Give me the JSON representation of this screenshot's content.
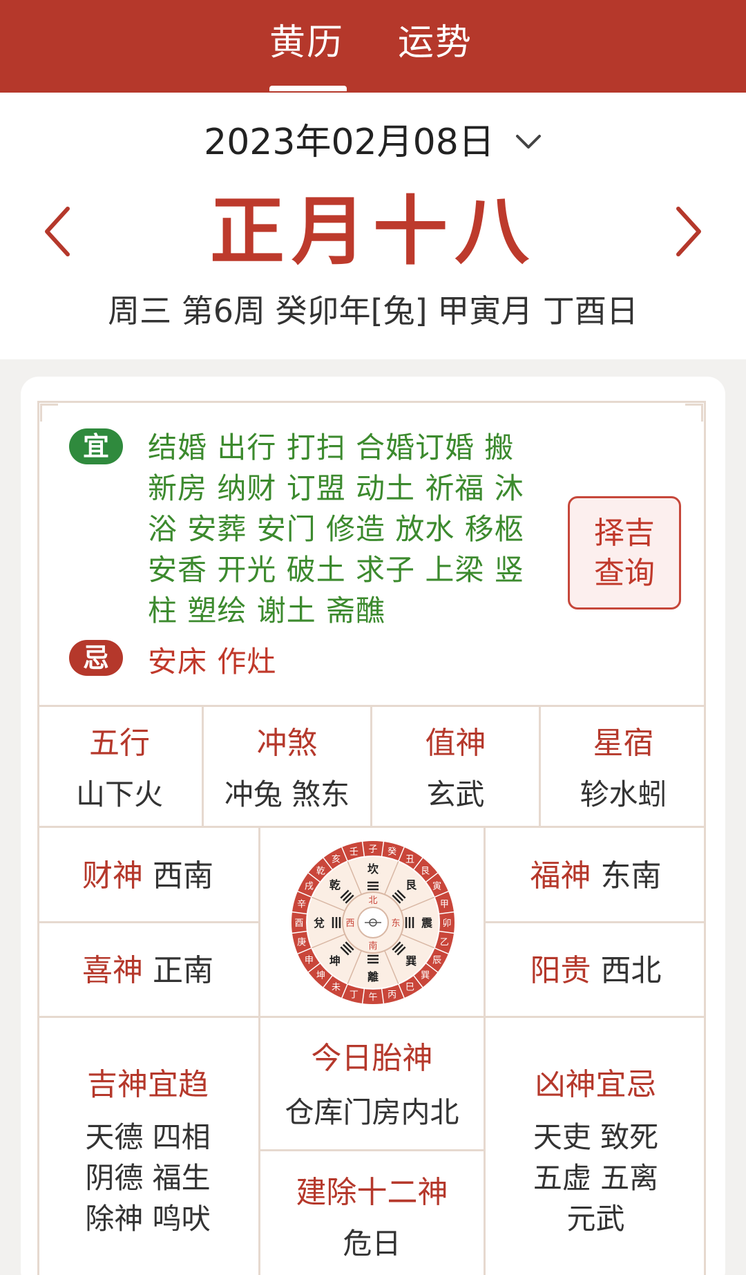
{
  "tabs": [
    {
      "label": "黄历",
      "active": true
    },
    {
      "label": "运势",
      "active": false
    }
  ],
  "header": {
    "date": "2023年02月08日",
    "lunar_date": "正月十八",
    "ganzhi": "周三 第6周 癸卯年[兔] 甲寅月 丁酉日"
  },
  "yi": {
    "badge": "宜",
    "lines": [
      "结婚 出行 打扫 合婚订婚 搬",
      "新房 纳财 订盟 动土 祈福 沐",
      "浴 安葬 安门 修造 放水 移柩",
      "安香 开光 破土 求子 上梁 竖",
      "柱 塑绘 谢土 斋醮"
    ]
  },
  "ji": {
    "badge": "忌",
    "text": "安床 作灶"
  },
  "zeji_button": {
    "line1": "择吉",
    "line2": "查询"
  },
  "attributes": [
    {
      "title": "五行",
      "value": "山下火"
    },
    {
      "title": "冲煞",
      "value": "冲兔 煞东"
    },
    {
      "title": "值神",
      "value": "玄武"
    },
    {
      "title": "星宿",
      "value": "轸水蚓"
    }
  ],
  "gods": {
    "caishen": {
      "title": "财神",
      "value": "西南"
    },
    "xishen": {
      "title": "喜神",
      "value": "正南"
    },
    "fushen": {
      "title": "福神",
      "value": "东南"
    },
    "yanggui": {
      "title": "阳贵",
      "value": "西北"
    }
  },
  "compass": {
    "ring": [
      "子",
      "癸",
      "丑",
      "艮",
      "寅",
      "甲",
      "卯",
      "乙",
      "辰",
      "巽",
      "巳",
      "丙",
      "午",
      "丁",
      "未",
      "坤",
      "申",
      "庚",
      "酉",
      "辛",
      "戌",
      "乾",
      "亥",
      "壬"
    ],
    "trigram_names": [
      "坎",
      "艮",
      "震",
      "巽",
      "離",
      "坤",
      "兌",
      "乾"
    ],
    "directions": [
      "北",
      "东",
      "南",
      "西"
    ],
    "colors": {
      "outer": "#c9463a",
      "inner": "#fbeee4",
      "text": "#333333"
    }
  },
  "jishen": {
    "title": "吉神宜趋",
    "lines": [
      "天德 四相",
      "阴德 福生",
      "除神 鸣吠"
    ]
  },
  "taishen": {
    "title": "今日胎神",
    "value": "仓库门房内北"
  },
  "jianchu": {
    "title": "建除十二神",
    "value": "危日"
  },
  "xiongshen": {
    "title": "凶神宜忌",
    "lines": [
      "天吏 致死",
      "五虚 五离",
      "元武"
    ]
  },
  "colors": {
    "brand_red": "#b5382b",
    "yi_green": "#2f8a3d",
    "border_beige": "#e6d9cf"
  }
}
